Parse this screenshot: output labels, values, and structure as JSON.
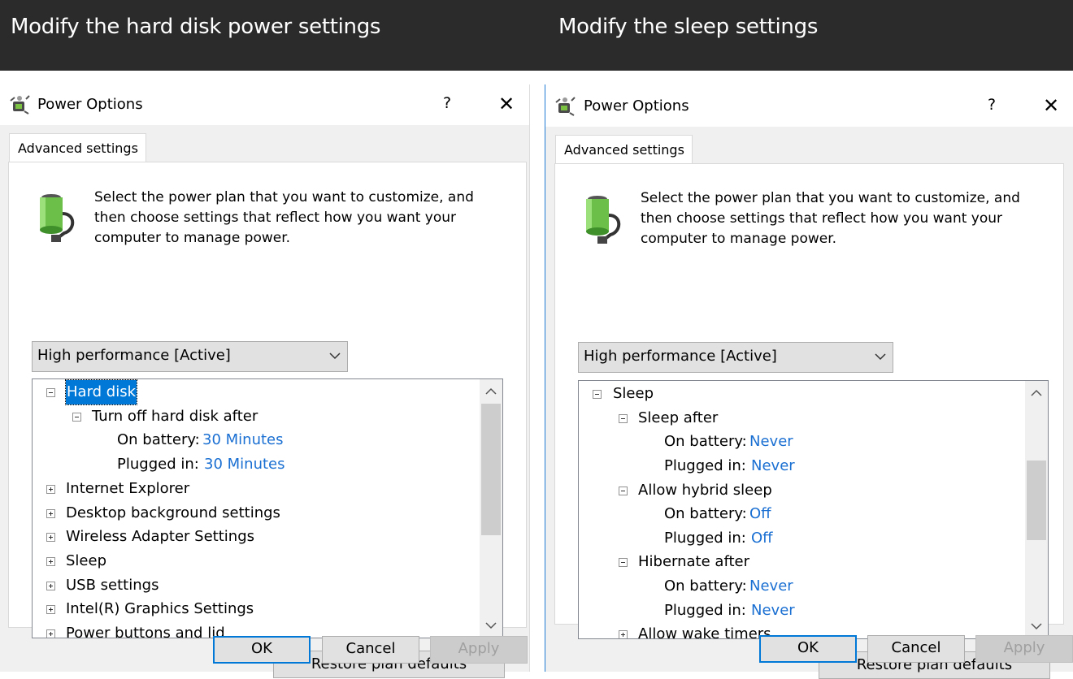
{
  "banner": {
    "left_title": "Modify the hard disk power settings",
    "right_title": "Modify the sleep settings"
  },
  "left_dialog": {
    "title": "Power Options",
    "help": "?",
    "close": "✕",
    "tab": "Advanced settings",
    "description": "Select the power plan that you want to customize, and then choose settings that reflect how you want your computer to manage power.",
    "plan": "High performance [Active]",
    "tree": {
      "hard_disk": "Hard disk",
      "turn_off": "Turn off hard disk after",
      "on_battery_label": "On battery:",
      "on_battery_value": "30 Minutes",
      "plugged_in_label": "Plugged in:",
      "plugged_in_value": "30 Minutes",
      "internet_explorer": "Internet Explorer",
      "desktop_background": "Desktop background settings",
      "wireless_adapter": "Wireless Adapter Settings",
      "sleep": "Sleep",
      "usb": "USB settings",
      "intel_graphics": "Intel(R) Graphics Settings",
      "power_buttons": "Power buttons and lid"
    },
    "restore": "Restore plan defaults",
    "ok": "OK",
    "cancel": "Cancel",
    "apply": "Apply"
  },
  "right_dialog": {
    "title": "Power Options",
    "help": "?",
    "close": "✕",
    "tab": "Advanced settings",
    "description": "Select the power plan that you want to customize, and then choose settings that reflect how you want your computer to manage power.",
    "plan": "High performance [Active]",
    "tree": {
      "sleep": "Sleep",
      "sleep_after": "Sleep after",
      "sleep_after_battery_label": "On battery:",
      "sleep_after_battery_value": "Never",
      "sleep_after_plugged_label": "Plugged in:",
      "sleep_after_plugged_value": "Never",
      "hybrid": "Allow hybrid sleep",
      "hybrid_battery_label": "On battery:",
      "hybrid_battery_value": "Off",
      "hybrid_plugged_label": "Plugged in:",
      "hybrid_plugged_value": "Off",
      "hibernate": "Hibernate after",
      "hibernate_battery_label": "On battery:",
      "hibernate_battery_value": "Never",
      "hibernate_plugged_label": "Plugged in:",
      "hibernate_plugged_value": "Never",
      "wake_timers": "Allow wake timers"
    },
    "restore": "Restore plan defaults",
    "ok": "OK",
    "cancel": "Cancel",
    "apply": "Apply"
  },
  "colors": {
    "banner": "#2b2b2b",
    "selection": "#0078d7",
    "setting_value": "#1a6fd2",
    "dialog_bg": "#f0f0f0"
  },
  "icons": [
    "power-options-icon",
    "battery-plug-icon",
    "collapse-icon",
    "expand-icon",
    "chevron-down-icon",
    "scroll-up-icon",
    "scroll-down-icon",
    "close-icon"
  ]
}
